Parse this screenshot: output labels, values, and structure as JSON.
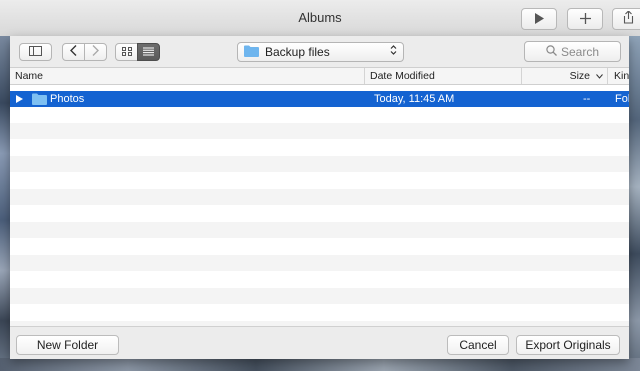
{
  "app": {
    "window_title": "Albums"
  },
  "toolbar_right": {
    "play_icon": "play-icon",
    "add_icon": "plus-icon",
    "share_icon": "share-icon"
  },
  "dialog": {
    "location": {
      "label": "Backup files",
      "icon": "folder-icon"
    },
    "search": {
      "placeholder": "Search",
      "icon": "magnifier-icon"
    },
    "view_mode": "list",
    "columns": [
      "Name",
      "Date Modified",
      "Size",
      "Kin"
    ],
    "sort_indicator": "chevron-down-icon",
    "rows": [
      {
        "name": "Photos",
        "date_modified": "Today, 11:45 AM",
        "size": "--",
        "kind": "Fol",
        "selected": true
      }
    ],
    "buttons": {
      "new_folder": "New Folder",
      "cancel": "Cancel",
      "export": "Export Originals"
    }
  },
  "colors": {
    "selection": "#1463d1",
    "background": "#ececec"
  }
}
